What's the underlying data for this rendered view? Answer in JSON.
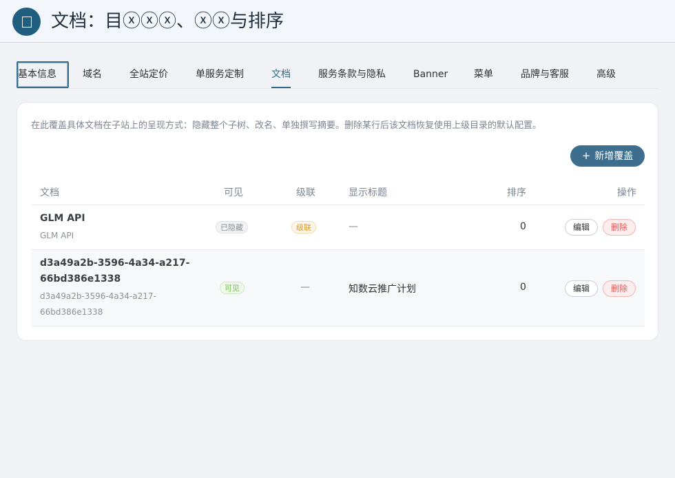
{
  "header": {
    "title": "文档：目ⓧⓧⓧ、ⓧⓧ与排序",
    "icon": "document-icon"
  },
  "tabs": [
    {
      "label": "基本信息"
    },
    {
      "label": "域名"
    },
    {
      "label": "全站定价"
    },
    {
      "label": "单服务定制"
    },
    {
      "label": "文档"
    },
    {
      "label": "服务条款与隐私"
    },
    {
      "label": "Banner"
    },
    {
      "label": "菜单"
    },
    {
      "label": "品牌与客服"
    },
    {
      "label": "高级"
    }
  ],
  "active_tab": "文档",
  "description": "在此覆盖具体文档在子站上的呈现方式：隐藏整个子树、改名、单独撰写摘要。删除某行后该文档恢复使用上级目录的默认配置。",
  "add_button": {
    "plus": "+",
    "label": "新增覆盖"
  },
  "table": {
    "headers": {
      "doc": "文档",
      "visible": "可见",
      "cascade": "级联",
      "display_title": "显示标题",
      "order": "排序",
      "actions": "操作"
    },
    "rows": [
      {
        "title": "GLM API",
        "subtitle": "GLM API",
        "visible": "已隐藏",
        "cascade": "级联",
        "display_title": "—",
        "order": "0",
        "edit": "编辑",
        "delete": "删除"
      },
      {
        "title_line1": "d3a49a2b-3596-4a34-a217-",
        "title_line2": "66bd386e1338",
        "subtitle_line1": "d3a49a2b-3596-4a34-a217-",
        "subtitle_line2": "66bd386e1338",
        "visible": "可见",
        "cascade": "—",
        "display_title": "知数云推广计划",
        "order": "0",
        "edit": "编辑",
        "delete": "删除"
      }
    ]
  },
  "colors": {
    "accent": "#2f6a8c",
    "primary_button": "#3d6e8d",
    "danger": "#e05a5a",
    "warning": "#d69b2d",
    "success": "#6cbf4a"
  }
}
